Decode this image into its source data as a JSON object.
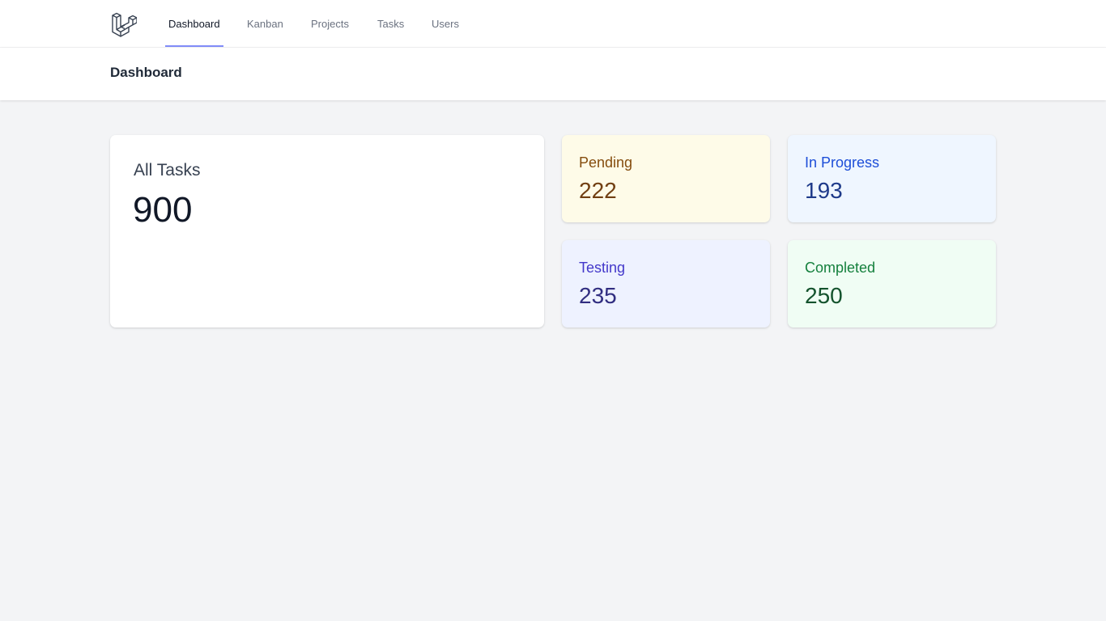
{
  "nav": {
    "logo_icon": "laravel-logo-icon",
    "items": [
      {
        "label": "Dashboard",
        "active": true
      },
      {
        "label": "Kanban",
        "active": false
      },
      {
        "label": "Projects",
        "active": false
      },
      {
        "label": "Tasks",
        "active": false
      },
      {
        "label": "Users",
        "active": false
      }
    ]
  },
  "header": {
    "title": "Dashboard"
  },
  "stats": {
    "all": {
      "label": "All Tasks",
      "value": "900"
    },
    "pending": {
      "label": "Pending",
      "value": "222",
      "color": "#854d0e",
      "background": "#fefbe8"
    },
    "in_progress": {
      "label": "In Progress",
      "value": "193",
      "color": "#1d4ed8",
      "background": "#eff6ff"
    },
    "testing": {
      "label": "Testing",
      "value": "235",
      "color": "#4338ca",
      "background": "#eef2ff"
    },
    "completed": {
      "label": "Completed",
      "value": "250",
      "color": "#15803d",
      "background": "#f0fdf4"
    }
  },
  "colors": {
    "page_background": "#f3f4f6",
    "active_nav_indicator": "#818cf8"
  }
}
